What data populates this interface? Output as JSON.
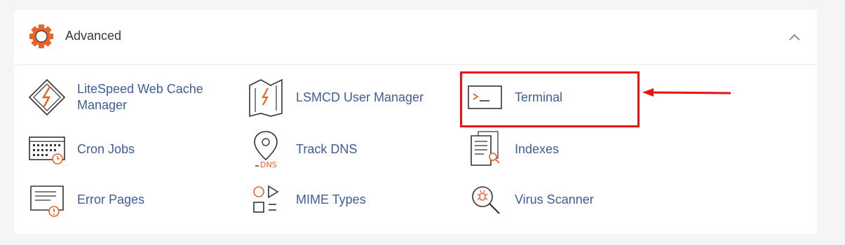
{
  "section": {
    "title": "Advanced",
    "icon": "gear-icon",
    "accent": "#e8622a",
    "link_color": "#3e5d99"
  },
  "items": [
    {
      "label": "LiteSpeed Web Cache Manager",
      "icon": "litespeed-icon"
    },
    {
      "label": "LSMCD User Manager",
      "icon": "lsmcd-icon"
    },
    {
      "label": "Terminal",
      "icon": "terminal-icon"
    },
    {
      "label": "Cron Jobs",
      "icon": "calendar-clock-icon"
    },
    {
      "label": "Track DNS",
      "icon": "map-pin-dns-icon"
    },
    {
      "label": "Indexes",
      "icon": "document-search-icon"
    },
    {
      "label": "Error Pages",
      "icon": "document-alert-icon"
    },
    {
      "label": "MIME Types",
      "icon": "shapes-icon"
    },
    {
      "label": "Virus Scanner",
      "icon": "magnifier-bug-icon"
    }
  ],
  "dns_badge": "DNS",
  "annotation": {
    "highlight_color": "#ee1111",
    "target": "Terminal"
  }
}
